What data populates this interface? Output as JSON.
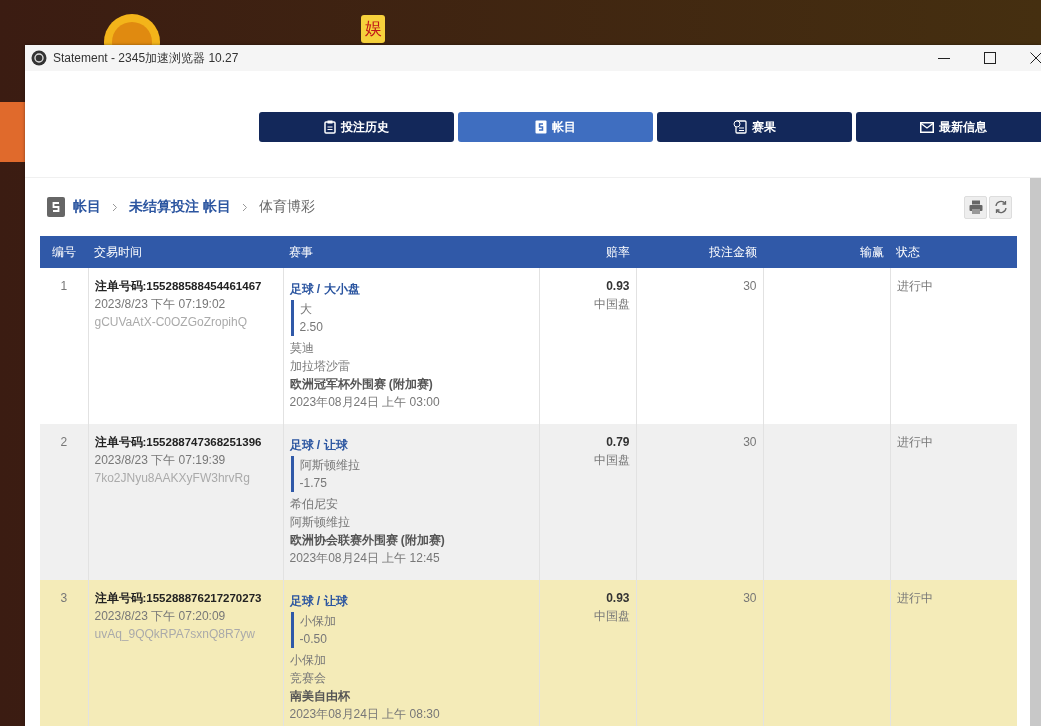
{
  "backdrop": {
    "badge": "娱"
  },
  "window": {
    "title": "Statement - 2345加速浏览器 10.27"
  },
  "tabs": [
    {
      "label": "投注历史",
      "selected": false
    },
    {
      "label": "帐目",
      "selected": true
    },
    {
      "label": "赛果",
      "selected": false
    },
    {
      "label": "最新信息",
      "selected": false
    }
  ],
  "breadcrumb": [
    {
      "label": "帐目",
      "link": true
    },
    {
      "label": "未结算投注 帐目",
      "link": true
    },
    {
      "label": "体育博彩",
      "link": false
    }
  ],
  "table": {
    "columns": [
      "编号",
      "交易时间",
      "赛事",
      "赔率",
      "投注金额",
      "输赢",
      "状态"
    ],
    "rows": [
      {
        "no": "1",
        "ticket": "注单号码:155288588454461467",
        "time": "2023/8/23 下午 07:19:02",
        "ref": "gCUVaAtX-C0OZGoZropihQ",
        "market": "足球 / 大小盘",
        "pick": "大",
        "line": "2.50",
        "home": "莫迪",
        "away": "加拉塔沙雷",
        "league": "欧洲冠军杯外围赛 (附加赛)",
        "kickoff": "2023年08月24日 上午 03:00",
        "odds": "0.93",
        "odds_type": "中国盘",
        "stake": "30",
        "status": "进行中",
        "highlighted": false
      },
      {
        "no": "2",
        "ticket": "注单号码:155288747368251396",
        "time": "2023/8/23 下午 07:19:39",
        "ref": "7ko2JNyu8AAKXyFW3hrvRg",
        "market": "足球 / 让球",
        "pick": "阿斯顿维拉",
        "line": "-1.75",
        "home": "希伯尼安",
        "away": "阿斯顿维拉",
        "league": "欧洲协会联赛外围赛 (附加赛)",
        "kickoff": "2023年08月24日 上午 12:45",
        "odds": "0.79",
        "odds_type": "中国盘",
        "stake": "30",
        "status": "进行中",
        "highlighted": false
      },
      {
        "no": "3",
        "ticket": "注单号码:155288876217270273",
        "time": "2023/8/23 下午 07:20:09",
        "ref": "uvAq_9QQkRPA7sxnQ8R7yw",
        "market": "足球 / 让球",
        "pick": "小保加",
        "line": "-0.50",
        "home": "小保加",
        "away": "竞赛会",
        "league": "南美自由杯",
        "kickoff": "2023年08月24日 上午 08:30",
        "odds": "0.93",
        "odds_type": "中国盘",
        "stake": "30",
        "status": "进行中",
        "highlighted": true
      }
    ]
  }
}
